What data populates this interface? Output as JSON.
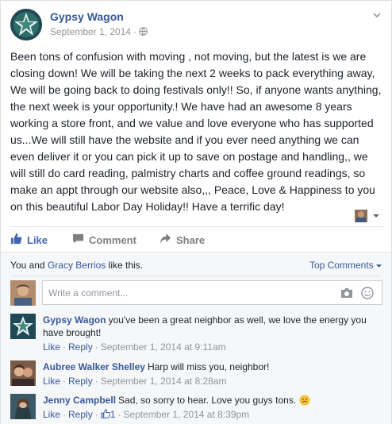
{
  "post": {
    "author": "Gypsy Wagon",
    "date": "September 1, 2014",
    "separator": "·",
    "body": "Been tons of confusion with moving , not moving, but the latest is we are closing down! We will be taking the next 2 weeks to pack everything away, We will be going back to doing festivals only!! So, if anyone wants anything, the next week is your opportunity.! We have had an awesome 8 years working a store front, and we value and love everyone who has supported us...We will still have the website and if you ever need anything we can even deliver it or you can pick it up to save on postage and handling,, we will still do card reading, palmistry charts and coffee ground readings, so make an appt through our website also,,, Peace, Love & Happiness to you on this beautiful Labor Day Holiday!! Have a terrific day!"
  },
  "actions": {
    "like": "Like",
    "comment": "Comment",
    "share": "Share"
  },
  "likes": {
    "prefix": "You and",
    "name": "Gracy Berrios",
    "suffix": "like this."
  },
  "sort": {
    "label": "Top Comments"
  },
  "composer": {
    "placeholder": "Write a comment..."
  },
  "comments": [
    {
      "name": "Gypsy Wagon",
      "text": "you've been a great neighbor as well, we love the energy you have brought!",
      "like": "Like",
      "reply": "Reply",
      "sep": "·",
      "time": "September 1, 2014 at 9:11am"
    },
    {
      "name": "Aubree Walker Shelley",
      "text": "Harp will miss you, neighbor!",
      "like": "Like",
      "reply": "Reply",
      "sep": "·",
      "time": "September 1, 2014 at 8:28am"
    },
    {
      "name": "Jenny Campbell",
      "text": "Sad, so sorry to hear. Love you guys tons.",
      "like": "Like",
      "reply": "Reply",
      "sep": "·",
      "like_count": "1",
      "time": "September 1, 2014 at 8:39pm"
    }
  ],
  "colors": {
    "link": "#365899",
    "like_active": "#4267b2",
    "muted": "#90949c",
    "comments_bg": "#f6f7f9"
  },
  "icons": [
    "globe-icon",
    "chevron-down-icon",
    "thumbs-up-icon",
    "comment-icon",
    "share-icon",
    "camera-icon",
    "emoji-icon",
    "smiley-icon"
  ]
}
